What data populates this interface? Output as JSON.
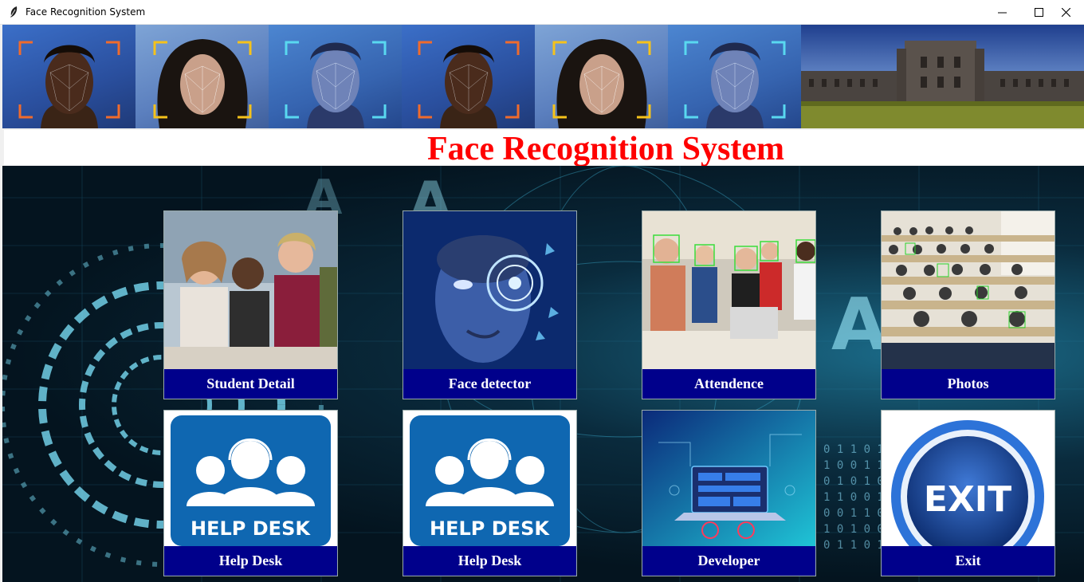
{
  "window": {
    "title": "Face Recognition System",
    "controls": [
      "minimize-icon",
      "maximize-icon",
      "close-icon"
    ]
  },
  "heading": "Face Recognition System",
  "colors": {
    "heading": "#ff0000",
    "tile_label_bg": "#00008b",
    "tile_label_text": "#ffffff"
  },
  "header_images": [
    "face-scan-man",
    "face-scan-woman",
    "face-scan-man-blue",
    "face-scan-man",
    "face-scan-woman",
    "face-scan-man-blue",
    "university-building"
  ],
  "tiles": [
    {
      "label": "Student Detail",
      "icon": "students-photo"
    },
    {
      "label": "Face detector",
      "icon": "face-scan-photo"
    },
    {
      "label": "Attendence",
      "icon": "classroom-photo"
    },
    {
      "label": "Photos",
      "icon": "lecture-hall-photo"
    },
    {
      "label": "Help Desk",
      "icon": "help-desk-icon",
      "image_text": "HELP DESK"
    },
    {
      "label": "Help Desk",
      "icon": "help-desk-icon",
      "image_text": "HELP DESK"
    },
    {
      "label": "Developer",
      "icon": "developer-laptop-icon"
    },
    {
      "label": "Exit",
      "icon": "exit-button-icon",
      "image_text": "EXIT"
    }
  ]
}
